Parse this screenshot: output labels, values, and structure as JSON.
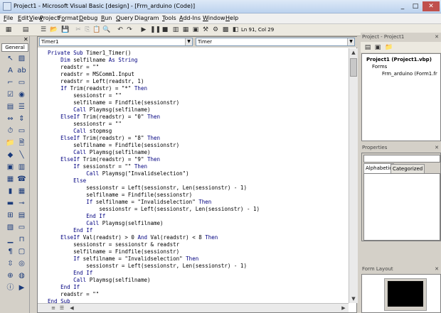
{
  "window": {
    "title": "Project1 - Microsoft Visual Basic [design] - [Frm_arduino (Code)]",
    "controls": [
      "_",
      "□",
      "✕"
    ]
  },
  "menu": [
    "File",
    "Edit",
    "View",
    "Project",
    "Format",
    "Debug",
    "Run",
    "Query",
    "Diagram",
    "Tools",
    "Add-Ins",
    "Window",
    "Help"
  ],
  "menu_mnemonics": [
    "F",
    "E",
    "V",
    "P",
    "o",
    "D",
    "R",
    "Q",
    "g",
    "T",
    "A",
    "W",
    "H"
  ],
  "toolbar": {
    "position": "Ln 91, Col 29"
  },
  "toolbox": {
    "tab": "General"
  },
  "code_window": {
    "object_combo": "Timer1",
    "procedure_combo": "Timer",
    "lines": [
      "Private Sub Timer1_Timer()",
      "    Dim selfilname As String",
      "    readstr = \"\"",
      "    readstr = MSComm1.Input",
      "    readstr = Left(readstr, 1)",
      "    If Trim(readstr) = \"*\" Then",
      "        sessionstr = \"\"",
      "        selfilname = Findfile(sessionstr)",
      "        Call Playmsg(selfilname)",
      "    ElseIf Trim(readstr) = \"0\" Then",
      "        sessionstr = \"\"",
      "        Call stopmsg",
      "    ElseIf Trim(readstr) = \"8\" Then",
      "        selfilname = Findfile(sessionstr)",
      "        Call Playmsg(selfilname)",
      "    ElseIf Trim(readstr) = \"9\" Then",
      "        If sessionstr = \"\" Then",
      "            Call Playmsg(\"Invalidselection\")",
      "        Else",
      "            sessionstr = Left(sessionstr, Len(sessionstr) - 1)",
      "            selfilname = Findfile(sessionstr)",
      "            If selfilname = \"Invalidselection\" Then",
      "                sessionstr = Left(sessionstr, Len(sessionstr) - 1)",
      "            End If",
      "            Call Playmsg(selfilname)",
      "        End If",
      "    ElseIf Val(readstr) > 0 And Val(readstr) < 8 Then",
      "        sessionstr = sessionstr & readstr",
      "        selfilname = Findfile(sessionstr)",
      "        If selfilname = \"Invalidselection\" Then",
      "            sessionstr = Left(sessionstr, Len(sessionstr) - 1)",
      "        End If",
      "        Call Playmsg(selfilname)",
      "    End If",
      "    readstr = \"\"",
      "End Sub"
    ],
    "keyword_color": "#000080",
    "text_color": "#000000"
  },
  "project_panel": {
    "header": "Project - Project1",
    "tree": [
      {
        "label": "Project1 (Project1.vbp)",
        "bold": true,
        "level": 0
      },
      {
        "label": "Forms",
        "bold": false,
        "level": 1
      },
      {
        "label": "Frm_arduino (Form1.fr",
        "bold": false,
        "level": 2
      }
    ]
  },
  "properties_panel": {
    "header": "Properties",
    "tabs": [
      "Alphabetic",
      "Categorized"
    ]
  },
  "form_layout_panel": {
    "header": "Form Layout"
  }
}
